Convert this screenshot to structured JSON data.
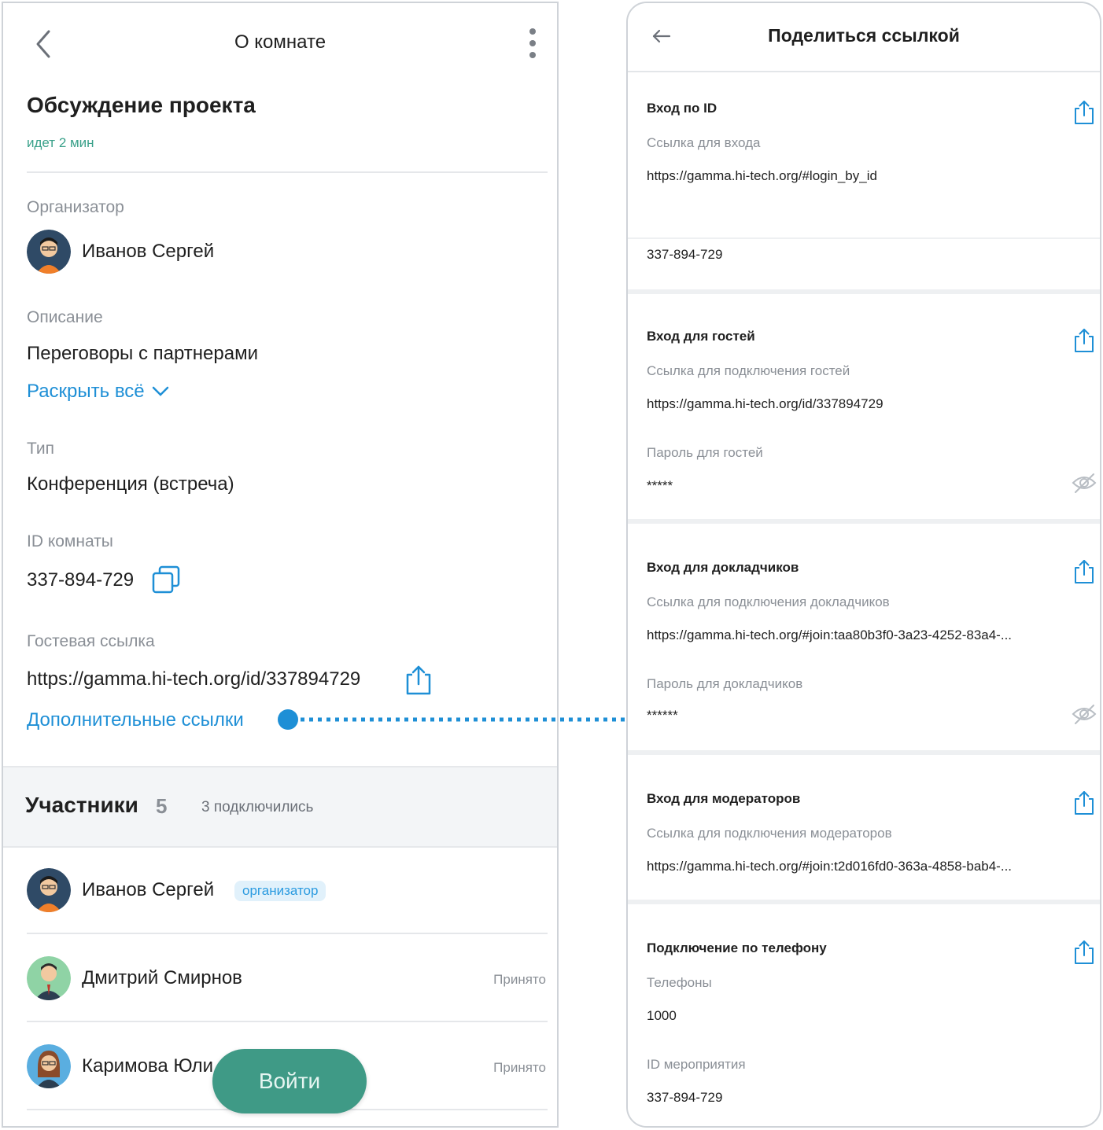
{
  "left": {
    "header_title": "О комнате",
    "room_title": "Обсуждение проекта",
    "duration": "идет 2 мин",
    "organizer_label": "Организатор",
    "organizer_name": "Иванов Сергей",
    "description_label": "Описание",
    "description_value": "Переговоры с партнерами",
    "expand_label": "Раскрыть всё",
    "type_label": "Тип",
    "type_value": "Конференция (встреча)",
    "room_id_label": "ID комнаты",
    "room_id_value": "337-894-729",
    "guest_link_label": "Гостевая ссылка",
    "guest_link_value": "https://gamma.hi-tech.org/id/337894729",
    "more_links_label": "Дополнительные ссылки",
    "participants_title": "Участники",
    "participants_count": "5",
    "participants_connected": "3 подключились",
    "participants": [
      {
        "name": "Иванов Сергей",
        "badge": "организатор",
        "status": ""
      },
      {
        "name": "Дмитрий Смирнов",
        "badge": "",
        "status": "Принято"
      },
      {
        "name": "Каримова Юли",
        "badge": "",
        "status": "Принято"
      }
    ],
    "enter_button": "Войти"
  },
  "right": {
    "header_title": "Поделиться ссылкой",
    "sections": [
      {
        "title": "Вход по ID",
        "link_label": "Ссылка для входа",
        "link_value": "https://gamma.hi-tech.org/#login_by_id",
        "id_value": "337-894-729"
      },
      {
        "title": "Вход для гостей",
        "link_label": "Ссылка для подключения гостей",
        "link_value": "https://gamma.hi-tech.org/id/337894729",
        "password_label": "Пароль для гостей",
        "password_value": "*****"
      },
      {
        "title": "Вход для докладчиков",
        "link_label": "Ссылка для подключения докладчиков",
        "link_value": "https://gamma.hi-tech.org/#join:taa80b3f0-3a23-4252-83a4-...",
        "password_label": "Пароль для докладчиков",
        "password_value": "******"
      },
      {
        "title": "Вход для модераторов",
        "link_label": "Ссылка для подключения модераторов",
        "link_value": "https://gamma.hi-tech.org/#join:t2d016fd0-363a-4858-bab4-..."
      },
      {
        "title": "Подключение по телефону",
        "phones_label": "Телефоны",
        "phones_value": "1000",
        "event_id_label": "ID мероприятия",
        "event_id_value": "337-894-729"
      }
    ]
  },
  "colors": {
    "accent_blue": "#1e8fd6",
    "enter_green": "#3f9a86",
    "gray_text": "#8a8f96"
  },
  "icons": [
    "back-chevron-icon",
    "kebab-menu-icon",
    "chevron-down-icon",
    "copy-icon",
    "share-icon",
    "eye-off-icon",
    "back-arrow-icon"
  ]
}
